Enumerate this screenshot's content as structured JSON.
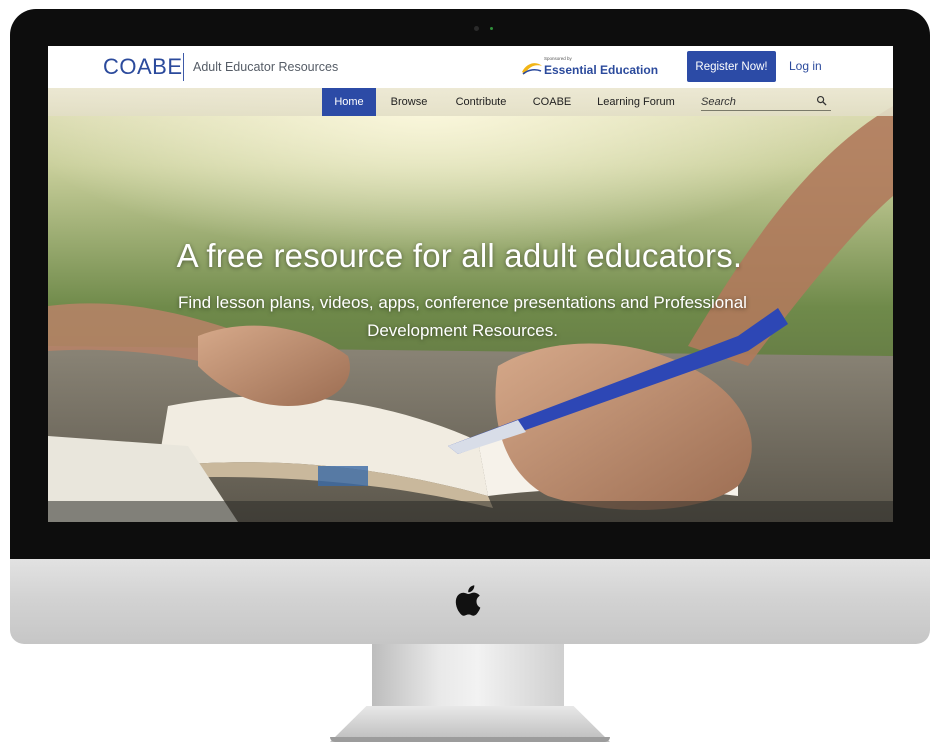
{
  "header": {
    "brand": "COABE",
    "tagline": "Adult Educator Resources",
    "sponsor": {
      "small_label": "Sponsored by",
      "name": "Essential Education"
    },
    "register_label": "Register Now!",
    "login_label": "Log in"
  },
  "nav": {
    "items": [
      {
        "label": "Home",
        "active": true
      },
      {
        "label": "Browse",
        "active": false
      },
      {
        "label": "Contribute",
        "active": false
      },
      {
        "label": "COABE",
        "active": false
      },
      {
        "label": "Learning Forum",
        "active": false
      }
    ],
    "search_placeholder": "Search"
  },
  "hero": {
    "title": "A free resource for all adult educators.",
    "subtitle": "Find lesson plans, videos, apps, conference presentations and Professional Development Resources."
  },
  "colors": {
    "brand_blue": "#2b4a9c",
    "active_nav": "#2c4ba6",
    "navbar_bg": "#ece8d4"
  },
  "icons": [
    "search-icon",
    "apple-logo-icon",
    "camera-icon",
    "sponsor-logo-icon"
  ]
}
